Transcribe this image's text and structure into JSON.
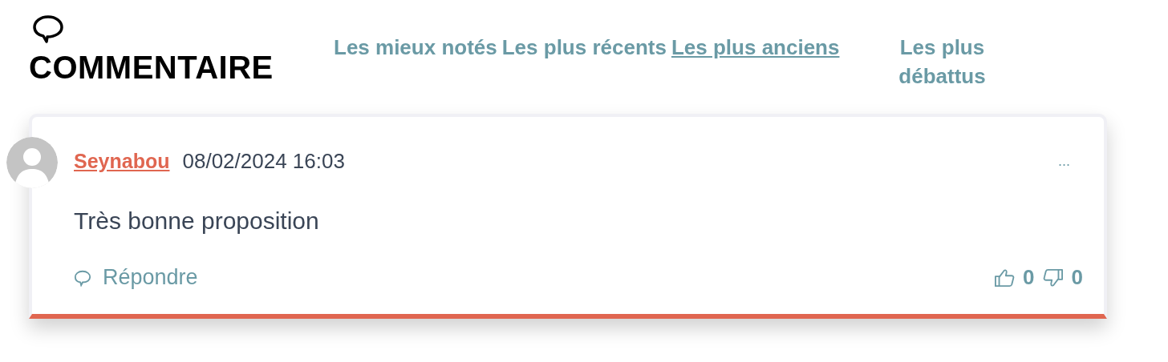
{
  "header": {
    "title": "COMMENTAIRE"
  },
  "sort_tabs": [
    {
      "label": "Les mieux notés",
      "selected": false
    },
    {
      "label": "Les plus récents",
      "selected": false
    },
    {
      "label": "Les plus anciens",
      "selected": true
    },
    {
      "label": "Les plus débattus",
      "selected": false
    }
  ],
  "comments": [
    {
      "author": "Seynabou",
      "date": "08/02/2024 16:03",
      "menu": "...",
      "text": "Très bonne proposition",
      "reply": "Répondre",
      "likes": "0",
      "dislikes": "0"
    }
  ]
}
